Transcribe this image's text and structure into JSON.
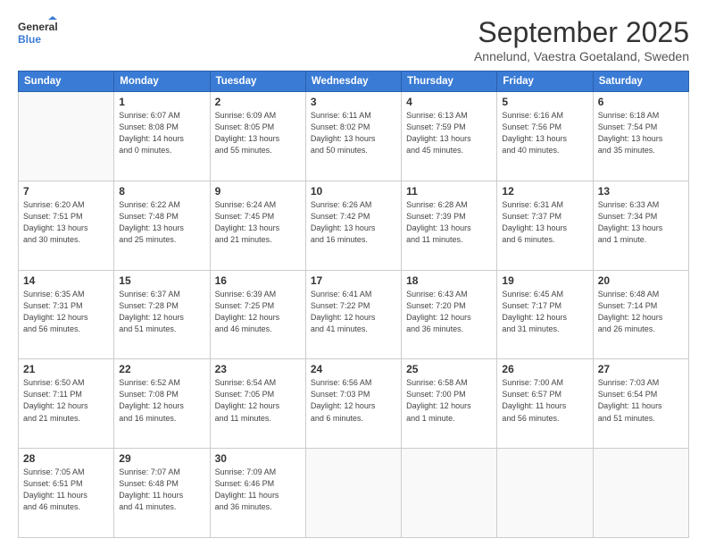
{
  "logo": {
    "general": "General",
    "blue": "Blue"
  },
  "header": {
    "month": "September 2025",
    "location": "Annelund, Vaestra Goetaland, Sweden"
  },
  "weekdays": [
    "Sunday",
    "Monday",
    "Tuesday",
    "Wednesday",
    "Thursday",
    "Friday",
    "Saturday"
  ],
  "weeks": [
    [
      {
        "day": "",
        "info": ""
      },
      {
        "day": "1",
        "info": "Sunrise: 6:07 AM\nSunset: 8:08 PM\nDaylight: 14 hours\nand 0 minutes."
      },
      {
        "day": "2",
        "info": "Sunrise: 6:09 AM\nSunset: 8:05 PM\nDaylight: 13 hours\nand 55 minutes."
      },
      {
        "day": "3",
        "info": "Sunrise: 6:11 AM\nSunset: 8:02 PM\nDaylight: 13 hours\nand 50 minutes."
      },
      {
        "day": "4",
        "info": "Sunrise: 6:13 AM\nSunset: 7:59 PM\nDaylight: 13 hours\nand 45 minutes."
      },
      {
        "day": "5",
        "info": "Sunrise: 6:16 AM\nSunset: 7:56 PM\nDaylight: 13 hours\nand 40 minutes."
      },
      {
        "day": "6",
        "info": "Sunrise: 6:18 AM\nSunset: 7:54 PM\nDaylight: 13 hours\nand 35 minutes."
      }
    ],
    [
      {
        "day": "7",
        "info": "Sunrise: 6:20 AM\nSunset: 7:51 PM\nDaylight: 13 hours\nand 30 minutes."
      },
      {
        "day": "8",
        "info": "Sunrise: 6:22 AM\nSunset: 7:48 PM\nDaylight: 13 hours\nand 25 minutes."
      },
      {
        "day": "9",
        "info": "Sunrise: 6:24 AM\nSunset: 7:45 PM\nDaylight: 13 hours\nand 21 minutes."
      },
      {
        "day": "10",
        "info": "Sunrise: 6:26 AM\nSunset: 7:42 PM\nDaylight: 13 hours\nand 16 minutes."
      },
      {
        "day": "11",
        "info": "Sunrise: 6:28 AM\nSunset: 7:39 PM\nDaylight: 13 hours\nand 11 minutes."
      },
      {
        "day": "12",
        "info": "Sunrise: 6:31 AM\nSunset: 7:37 PM\nDaylight: 13 hours\nand 6 minutes."
      },
      {
        "day": "13",
        "info": "Sunrise: 6:33 AM\nSunset: 7:34 PM\nDaylight: 13 hours\nand 1 minute."
      }
    ],
    [
      {
        "day": "14",
        "info": "Sunrise: 6:35 AM\nSunset: 7:31 PM\nDaylight: 12 hours\nand 56 minutes."
      },
      {
        "day": "15",
        "info": "Sunrise: 6:37 AM\nSunset: 7:28 PM\nDaylight: 12 hours\nand 51 minutes."
      },
      {
        "day": "16",
        "info": "Sunrise: 6:39 AM\nSunset: 7:25 PM\nDaylight: 12 hours\nand 46 minutes."
      },
      {
        "day": "17",
        "info": "Sunrise: 6:41 AM\nSunset: 7:22 PM\nDaylight: 12 hours\nand 41 minutes."
      },
      {
        "day": "18",
        "info": "Sunrise: 6:43 AM\nSunset: 7:20 PM\nDaylight: 12 hours\nand 36 minutes."
      },
      {
        "day": "19",
        "info": "Sunrise: 6:45 AM\nSunset: 7:17 PM\nDaylight: 12 hours\nand 31 minutes."
      },
      {
        "day": "20",
        "info": "Sunrise: 6:48 AM\nSunset: 7:14 PM\nDaylight: 12 hours\nand 26 minutes."
      }
    ],
    [
      {
        "day": "21",
        "info": "Sunrise: 6:50 AM\nSunset: 7:11 PM\nDaylight: 12 hours\nand 21 minutes."
      },
      {
        "day": "22",
        "info": "Sunrise: 6:52 AM\nSunset: 7:08 PM\nDaylight: 12 hours\nand 16 minutes."
      },
      {
        "day": "23",
        "info": "Sunrise: 6:54 AM\nSunset: 7:05 PM\nDaylight: 12 hours\nand 11 minutes."
      },
      {
        "day": "24",
        "info": "Sunrise: 6:56 AM\nSunset: 7:03 PM\nDaylight: 12 hours\nand 6 minutes."
      },
      {
        "day": "25",
        "info": "Sunrise: 6:58 AM\nSunset: 7:00 PM\nDaylight: 12 hours\nand 1 minute."
      },
      {
        "day": "26",
        "info": "Sunrise: 7:00 AM\nSunset: 6:57 PM\nDaylight: 11 hours\nand 56 minutes."
      },
      {
        "day": "27",
        "info": "Sunrise: 7:03 AM\nSunset: 6:54 PM\nDaylight: 11 hours\nand 51 minutes."
      }
    ],
    [
      {
        "day": "28",
        "info": "Sunrise: 7:05 AM\nSunset: 6:51 PM\nDaylight: 11 hours\nand 46 minutes."
      },
      {
        "day": "29",
        "info": "Sunrise: 7:07 AM\nSunset: 6:48 PM\nDaylight: 11 hours\nand 41 minutes."
      },
      {
        "day": "30",
        "info": "Sunrise: 7:09 AM\nSunset: 6:46 PM\nDaylight: 11 hours\nand 36 minutes."
      },
      {
        "day": "",
        "info": ""
      },
      {
        "day": "",
        "info": ""
      },
      {
        "day": "",
        "info": ""
      },
      {
        "day": "",
        "info": ""
      }
    ]
  ]
}
